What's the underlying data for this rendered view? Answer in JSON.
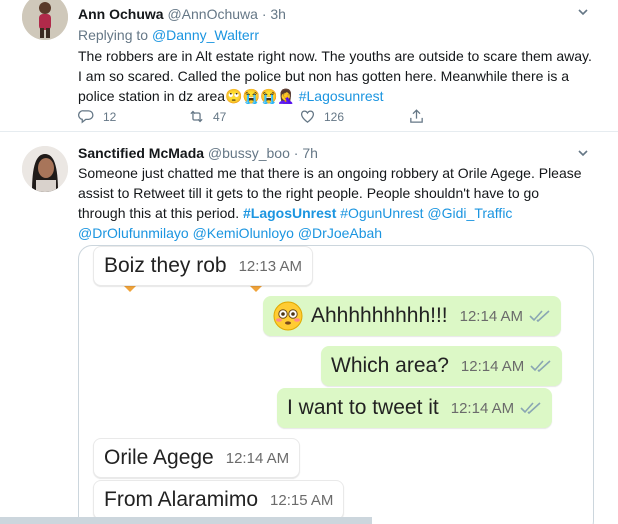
{
  "tweet1": {
    "name": "Ann Ochuwa",
    "handle": "@AnnOchuwa",
    "sep": "·",
    "time": "3h",
    "replying_prefix": "Replying to",
    "replying_to": "@Danny_Walterr",
    "text_line1": "The robbers are in Alt estate right now. The youths are outside to scare them away.",
    "text_line2": "I am so scared. Called the police but non has gotten here. Meanwhile there is a",
    "text_line3": "police station in dz area",
    "emojis": "🙄😭😭🤦‍♀️",
    "hashtag": "#Lagosunrest",
    "replies": "12",
    "retweets": "47",
    "likes": "126"
  },
  "tweet2": {
    "name": "Sanctified McMada",
    "handle": "@bussy_boo",
    "sep": "·",
    "time": "7h",
    "text_line1": "Someone just chatted me that there is an ongoing robbery at Orile Agege. Please",
    "text_line2": "assist to Retweet till it gets to the right people. People shouldn't have to go",
    "text_line3_plain": "through this at this period.",
    "tag_lagos": "#LagosUnrest",
    "tag_ogun": "#OgunUnrest",
    "tag_gidi": "@Gidi_Traffic",
    "tag_olufunmilayo": "@DrOlufunmilayo",
    "tag_kemi": "@KemiOlunloyo",
    "tag_joeabah": "@DrJoeAbah"
  },
  "chat": {
    "messages": [
      {
        "text": "Boiz they rob",
        "time": "12:13 AM"
      },
      {
        "text": "Ahhhhhhhhh!!!",
        "time": "12:14 AM"
      },
      {
        "text": "Which area?",
        "time": "12:14 AM"
      },
      {
        "text": "I want to tweet it",
        "time": "12:14 AM"
      },
      {
        "text": "Orile Agege",
        "time": "12:14 AM"
      },
      {
        "text": "From Alaramimo",
        "time": "12:15 AM"
      }
    ]
  },
  "colors": {
    "link": "#1b95e0",
    "muted": "#657786",
    "outgoing_bubble": "#dcf8c6",
    "read_checks": "#8aa6b3"
  },
  "icons": [
    "reply-icon",
    "retweet-icon",
    "like-icon",
    "share-icon",
    "chevron-down-icon",
    "double-check-icon",
    "flushed-face-icon"
  ]
}
